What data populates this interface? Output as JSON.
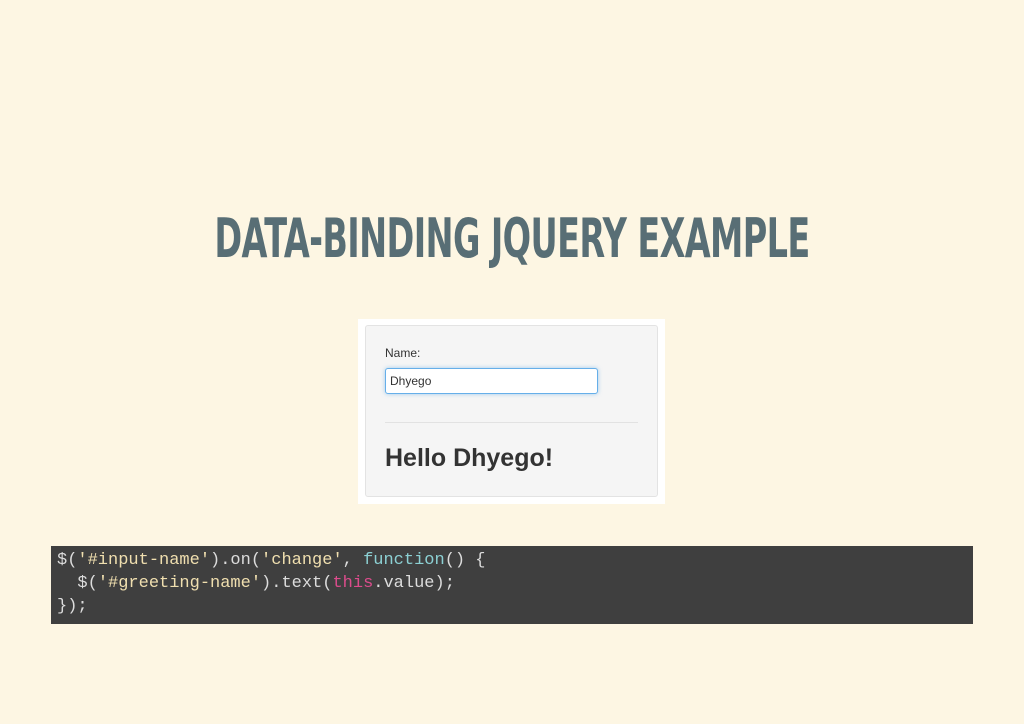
{
  "slide": {
    "title": "DATA-BINDING JQUERY EXAMPLE"
  },
  "demo": {
    "name_label": "Name:",
    "name_value": "Dhyego",
    "greeting": "Hello Dhyego!"
  },
  "code": {
    "line1": {
      "p1": "$(",
      "s1": "'#input-name'",
      "p2": ").on(",
      "s2": "'change'",
      "p3": ", ",
      "k1": "function",
      "p4": "() {"
    },
    "line2": {
      "p1": "  $(",
      "s1": "'#greeting-name'",
      "p2": ").text(",
      "k1": "this",
      "p3": ".value);"
    },
    "line3": {
      "p1": "});"
    }
  },
  "colors": {
    "background": "#fdf6e3",
    "title": "#586e75",
    "code_background": "#3f3f3f",
    "code_string": "#f0dfaf",
    "code_keyword": "#8cd0d3",
    "code_this": "#dc4c8c",
    "input_focus": "#66afe9"
  }
}
